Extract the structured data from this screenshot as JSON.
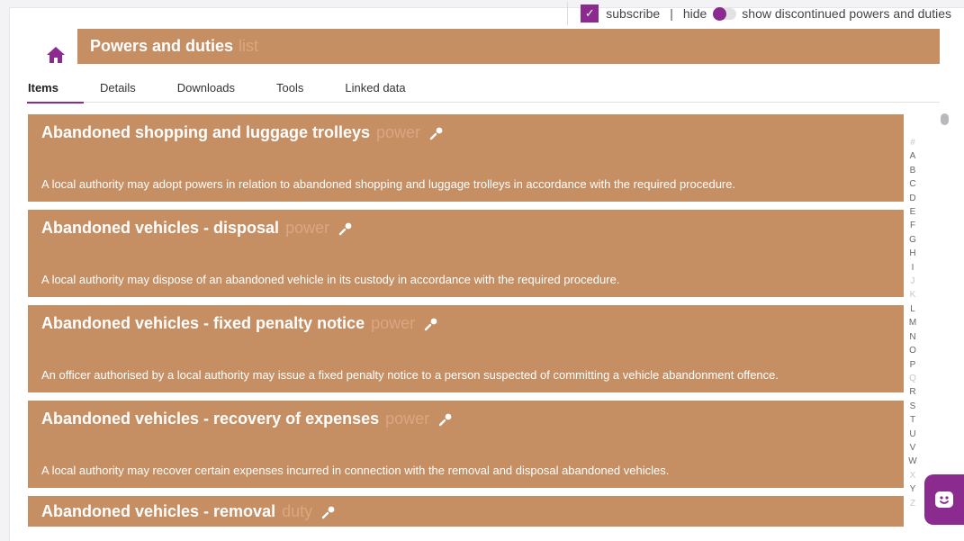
{
  "topbar": {
    "subscribe_label": "subscribe",
    "separator": "|",
    "hide_label": "hide",
    "show_label": "show discontinued powers and duties"
  },
  "header": {
    "title": "Powers and duties",
    "kind": "list"
  },
  "tabs": [
    {
      "label": "Items",
      "active": true
    },
    {
      "label": "Details",
      "active": false
    },
    {
      "label": "Downloads",
      "active": false
    },
    {
      "label": "Tools",
      "active": false
    },
    {
      "label": "Linked data",
      "active": false
    }
  ],
  "items": [
    {
      "name": "Abandoned shopping and luggage trolleys",
      "type": "power",
      "description": "A local authority may adopt powers in relation to abandoned shopping and luggage trolleys in accordance with the required procedure."
    },
    {
      "name": "Abandoned vehicles - disposal",
      "type": "power",
      "description": "A local authority may dispose of an abandoned vehicle in its custody in accordance with the required procedure."
    },
    {
      "name": "Abandoned vehicles - fixed penalty notice",
      "type": "power",
      "description": "An officer authorised by a local authority may issue a fixed penalty notice to a person suspected of committing a vehicle abandonment offence."
    },
    {
      "name": "Abandoned vehicles - recovery of expenses",
      "type": "power",
      "description": "A local authority may recover certain expenses incurred in connection with the removal and disposal abandoned vehicles."
    },
    {
      "name": "Abandoned vehicles - removal",
      "type": "duty",
      "description": ""
    }
  ],
  "alphabet": [
    "#",
    "A",
    "B",
    "C",
    "D",
    "E",
    "F",
    "G",
    "H",
    "I",
    "J",
    "K",
    "L",
    "M",
    "N",
    "O",
    "P",
    "Q",
    "R",
    "S",
    "T",
    "U",
    "V",
    "W",
    "X",
    "Y",
    "Z"
  ],
  "alphabet_dimmed": [
    "#",
    "J",
    "K",
    "Q",
    "X",
    "Z"
  ],
  "colors": {
    "accent": "#8b2a8f",
    "item_background": "#c68e63",
    "type_text": "#dba681"
  }
}
